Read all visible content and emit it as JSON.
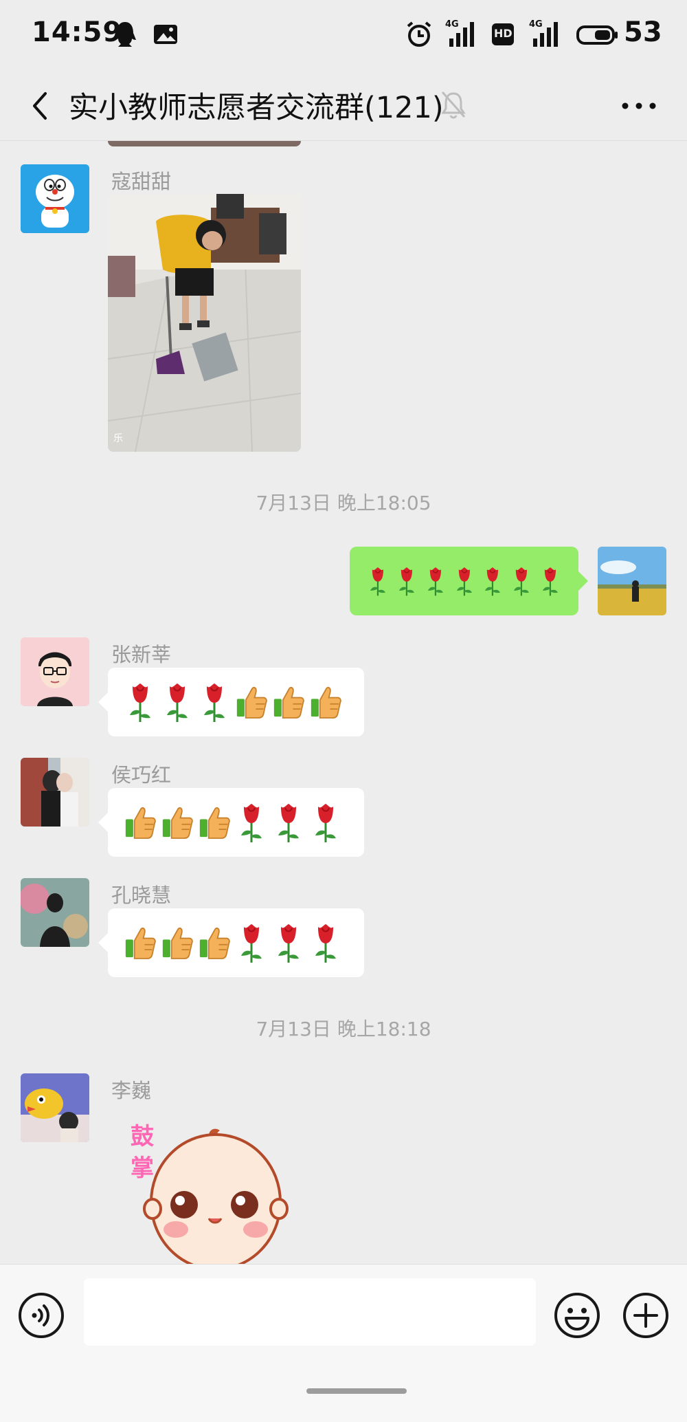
{
  "status_bar": {
    "time": "14:59",
    "network_1": "4G",
    "network_2": "4G",
    "hd": "HD",
    "battery": "53"
  },
  "title_bar": {
    "title": "实小教师志愿者交流群(121)",
    "icons": [
      "back-icon",
      "mute-bell-icon",
      "more-icon"
    ]
  },
  "messages": [
    {
      "type": "image",
      "sender": "寇甜甜",
      "avatar": "doraemon-avatar",
      "content": "photo of teacher sweeping floor"
    },
    {
      "type": "timestamp",
      "text": "7月13日 晚上18:05"
    },
    {
      "type": "self",
      "emojis": [
        "rose",
        "rose",
        "rose",
        "rose",
        "rose",
        "rose",
        "rose"
      ]
    },
    {
      "type": "text",
      "sender": "张新莘",
      "emojis": [
        "rose",
        "rose",
        "rose",
        "thumbs-up",
        "thumbs-up",
        "thumbs-up"
      ]
    },
    {
      "type": "text",
      "sender": "侯巧红",
      "emojis": [
        "thumbs-up",
        "thumbs-up",
        "thumbs-up",
        "rose",
        "rose",
        "rose"
      ]
    },
    {
      "type": "text",
      "sender": "孔晓慧",
      "emojis": [
        "thumbs-up",
        "thumbs-up",
        "thumbs-up",
        "rose",
        "rose",
        "rose"
      ]
    },
    {
      "type": "timestamp",
      "text": "7月13日 晚上18:18"
    },
    {
      "type": "sticker",
      "sender": "李巍",
      "sticker_text": [
        "鼓",
        "掌"
      ]
    }
  ],
  "input_bar": {
    "value": "",
    "icons": [
      "voice-icon",
      "emoji-icon",
      "plus-icon"
    ]
  },
  "colors": {
    "self_bubble": "#95ec69",
    "background": "#ededed"
  }
}
